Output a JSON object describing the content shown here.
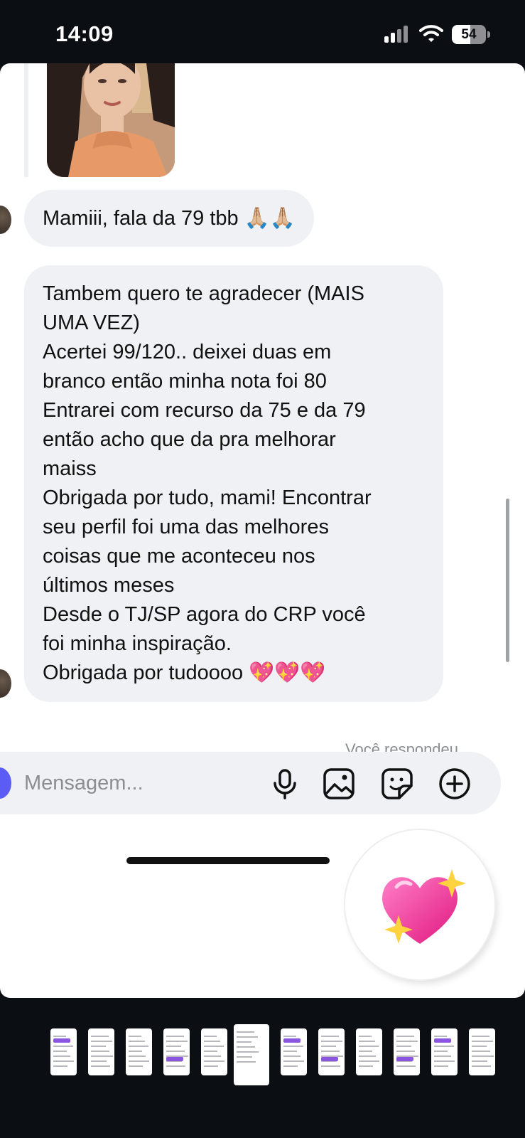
{
  "status_bar": {
    "time": "14:09",
    "battery_level": "54",
    "icons": [
      "signal-icon",
      "wifi-icon",
      "battery-icon"
    ]
  },
  "conversation": {
    "photo_message": {
      "icon": "photo-thumbnail"
    },
    "messages": [
      {
        "text": "Mamiii, fala da 79 tbb 🙏🏼🙏🏼"
      },
      {
        "lines": [
          "Tambem quero te agradecer (MAIS",
          "UMA VEZ)",
          "Acertei 99/120.. deixei duas em",
          "branco então minha nota foi 80",
          "Entrarei com recurso da 75 e da 79",
          "então acho que da pra melhorar",
          "maiss",
          "Obrigada por tudo, mami! Encontrar",
          "seu perfil foi uma das melhores",
          "coisas que me aconteceu nos",
          "últimos meses",
          "Desde o TJ/SP agora do CRP você",
          "foi minha inspiração.",
          "Obrigada por tudoooo 💖💖💖"
        ]
      }
    ],
    "replied_note": "Você respondeu"
  },
  "composer": {
    "placeholder": "Mensagem...",
    "icons": [
      "microphone-icon",
      "image-icon",
      "sticker-icon",
      "plus-icon"
    ]
  },
  "sticker": {
    "emoji": "💖"
  },
  "thumbnails": {
    "count": 12,
    "active_index": 5
  },
  "colors": {
    "bubble": "#f0f1f4",
    "accent": "#5b5bf6",
    "background": "#0b0f14"
  }
}
